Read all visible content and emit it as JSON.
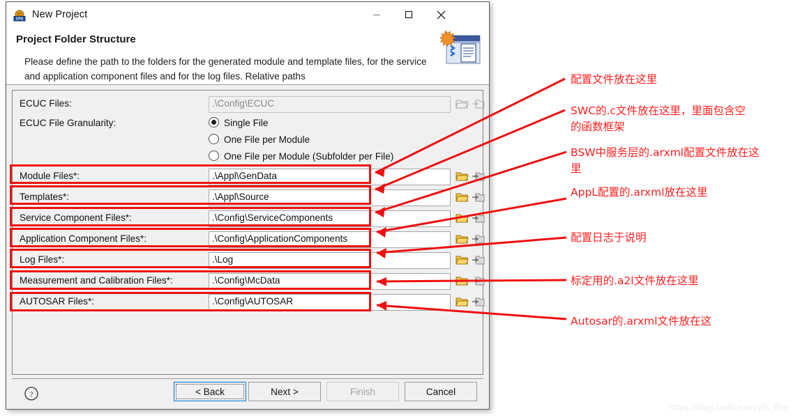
{
  "window": {
    "title": "New Project",
    "app_icon": "cfg-project-icon",
    "controls": {
      "minimize": "minimize-icon",
      "maximize": "maximize-icon",
      "close": "close-icon"
    }
  },
  "header": {
    "title": "Project Folder Structure",
    "description": "Please define the path to the folders for the generated module and template files, for the service and application component files and for the log files. Relative paths",
    "banner_icon": "wizard-banner-icon"
  },
  "form": {
    "ecuc": {
      "label": "ECUC Files:",
      "value": ".\\Config\\ECUC",
      "disabled": true
    },
    "granularity": {
      "label": "ECUC File Granularity:",
      "options": [
        {
          "label": "Single File",
          "selected": true
        },
        {
          "label": "One File per Module",
          "selected": false
        },
        {
          "label": "One File per Module (Subfolder per File)",
          "selected": false
        }
      ]
    },
    "fields": [
      {
        "label": "Module Files*:",
        "value": ".\\Appl\\GenData"
      },
      {
        "label": "Templates*:",
        "value": ".\\Appl\\Source"
      },
      {
        "label": "Service Component Files*:",
        "value": ".\\Config\\ServiceComponents"
      },
      {
        "label": "Application Component Files*:",
        "value": ".\\Config\\ApplicationComponents"
      },
      {
        "label": "Log Files*:",
        "value": ".\\Log"
      },
      {
        "label": "Measurement and Calibration Files*:",
        "value": ".\\Config\\McData"
      },
      {
        "label": "AUTOSAR Files*:",
        "value": ".\\Config\\AUTOSAR"
      }
    ],
    "icons": {
      "browse_folder": "folder-open-icon",
      "pick_folder": "folder-select-icon"
    }
  },
  "buttons": {
    "help": "help-icon",
    "back": {
      "label": "< Back",
      "enabled": true,
      "default": true
    },
    "next": {
      "label": "Next >",
      "enabled": true,
      "default": false
    },
    "finish": {
      "label": "Finish",
      "enabled": false,
      "default": false
    },
    "cancel": {
      "label": "Cancel",
      "enabled": true,
      "default": false
    }
  },
  "annotations": [
    {
      "text": "配置文件放在这里"
    },
    {
      "text": "SWC的.c文件放在这里，里面包含空\n的函数框架"
    },
    {
      "text": "BSW中服务层的.arxml配置文件放在这\n里"
    },
    {
      "text": "AppL配置的.arxml放在这里"
    },
    {
      "text": "配置日志于说明"
    },
    {
      "text": "标定用的.a2l文件放在这里"
    },
    {
      "text": "Autosar的.arxml文件放在这"
    }
  ],
  "colors": {
    "annotation_red": "#ff2020",
    "box_red": "#ee1111",
    "accent_blue": "#0078d7"
  },
  "watermark": "https://blog.csdn.net/xyfx_fhw"
}
